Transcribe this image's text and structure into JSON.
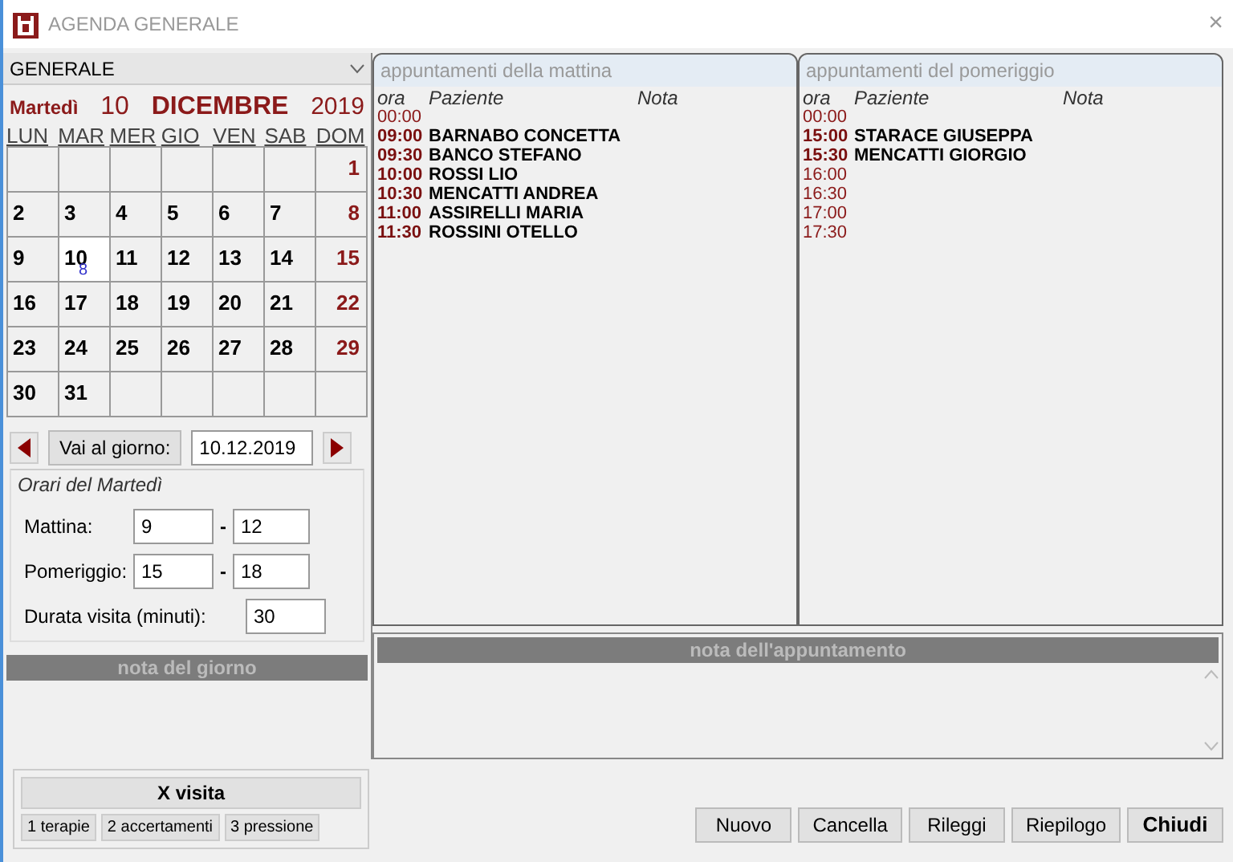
{
  "window": {
    "title": "AGENDA GENERALE",
    "close": "×"
  },
  "agenda_select": {
    "value": "GENERALE"
  },
  "calendar": {
    "weekday": "Martedì",
    "day": "10",
    "month": "DICEMBRE",
    "year": "2019",
    "day_headers": [
      "LUN",
      "MAR",
      "MER",
      "GIO",
      "VEN",
      "SAB",
      "DOM"
    ],
    "weeks": [
      [
        {
          "kind": "blank"
        },
        {
          "kind": "blank"
        },
        {
          "kind": "blank"
        },
        {
          "kind": "blank"
        },
        {
          "kind": "blank"
        },
        {
          "kind": "blank"
        },
        {
          "day": "1",
          "selected": false
        }
      ],
      [
        {
          "day": "2",
          "selected": false
        },
        {
          "day": "3",
          "selected": false
        },
        {
          "day": "4",
          "selected": false
        },
        {
          "day": "5",
          "selected": false
        },
        {
          "day": "6",
          "selected": false
        },
        {
          "day": "7",
          "selected": false
        },
        {
          "day": "8",
          "selected": false
        }
      ],
      [
        {
          "day": "9",
          "selected": false
        },
        {
          "day": "10",
          "selected": true,
          "count": "8"
        },
        {
          "day": "11",
          "selected": false
        },
        {
          "day": "12",
          "selected": false
        },
        {
          "day": "13",
          "selected": false
        },
        {
          "day": "14",
          "selected": false
        },
        {
          "day": "15",
          "selected": false
        }
      ],
      [
        {
          "day": "16",
          "selected": false
        },
        {
          "day": "17",
          "selected": false
        },
        {
          "day": "18",
          "selected": false
        },
        {
          "day": "19",
          "selected": false
        },
        {
          "day": "20",
          "selected": false
        },
        {
          "day": "21",
          "selected": false
        },
        {
          "day": "22",
          "selected": false
        }
      ],
      [
        {
          "day": "23",
          "selected": false
        },
        {
          "day": "24",
          "selected": false
        },
        {
          "day": "25",
          "selected": false
        },
        {
          "day": "26",
          "selected": false
        },
        {
          "day": "27",
          "selected": false
        },
        {
          "day": "28",
          "selected": false
        },
        {
          "day": "29",
          "selected": false
        }
      ],
      [
        {
          "day": "30",
          "selected": false
        },
        {
          "day": "31",
          "selected": false
        },
        {
          "kind": "blank"
        },
        {
          "kind": "blank"
        },
        {
          "kind": "blank"
        },
        {
          "kind": "blank"
        },
        {
          "kind": "blank"
        }
      ]
    ]
  },
  "goto": {
    "button": "Vai al giorno:",
    "date": "10.12.2019"
  },
  "hours": {
    "title": "Orari del Martedì",
    "morning_label": "Mattina:",
    "morning_from": "9",
    "morning_to": "12",
    "afternoon_label": "Pomeriggio:",
    "afternoon_from": "15",
    "afternoon_to": "18",
    "separator": "-",
    "duration_label": "Durata visita (minuti):",
    "duration": "30"
  },
  "day_note": {
    "title": "nota del giorno"
  },
  "visit": {
    "title": "X visita",
    "buttons": [
      "1 terapie",
      "2 accertamenti",
      "3 pressione"
    ]
  },
  "panels": [
    {
      "title": "appuntamenti della mattina",
      "columns": [
        "ora",
        "Paziente",
        "Nota"
      ],
      "rows": [
        {
          "time": "00:00",
          "booked": false
        },
        {
          "time": "09:00",
          "patient": "BARNABO CONCETTA",
          "booked": true
        },
        {
          "time": "09:30",
          "patient": "BANCO STEFANO",
          "booked": true
        },
        {
          "time": "10:00",
          "patient": "ROSSI LIO",
          "booked": true
        },
        {
          "time": "10:30",
          "patient": "MENCATTI ANDREA",
          "booked": true
        },
        {
          "time": "11:00",
          "patient": "ASSIRELLI MARIA",
          "booked": true
        },
        {
          "time": "11:30",
          "patient": "ROSSINI OTELLO",
          "booked": true
        }
      ]
    },
    {
      "title": "appuntamenti del pomeriggio",
      "columns": [
        "ora",
        "Paziente",
        "Nota"
      ],
      "rows": [
        {
          "time": "00:00",
          "booked": false
        },
        {
          "time": "15:00",
          "patient": "STARACE GIUSEPPA",
          "booked": true
        },
        {
          "time": "15:30",
          "patient": "MENCATTI GIORGIO",
          "booked": true
        },
        {
          "time": "16:00",
          "booked": false
        },
        {
          "time": "16:30",
          "booked": false
        },
        {
          "time": "17:00",
          "booked": false
        },
        {
          "time": "17:30",
          "booked": false
        }
      ]
    }
  ],
  "appointment_note": {
    "title": "nota dell'appuntamento"
  },
  "buttons": [
    {
      "label": "Nuovo",
      "default": false
    },
    {
      "label": "Cancella",
      "default": false
    },
    {
      "label": "Rileggi",
      "default": false
    },
    {
      "label": "Riepilogo",
      "default": false
    },
    {
      "label": "Chiudi",
      "default": true
    }
  ]
}
